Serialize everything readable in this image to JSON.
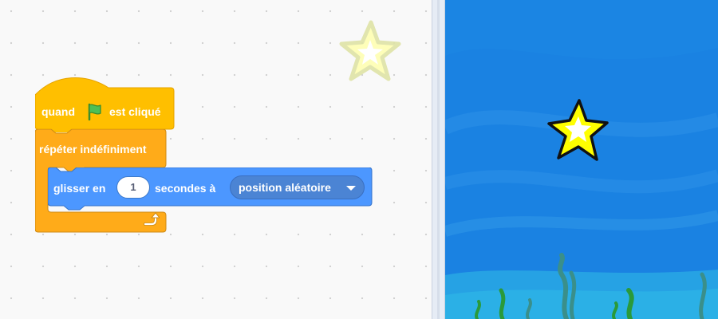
{
  "workspace": {
    "blocks": {
      "hat": {
        "label_before": "quand",
        "label_after": "est cliqué",
        "flag_icon": "green-flag-icon"
      },
      "repeat": {
        "label": "répéter indéfiniment",
        "loop_icon": "loop-arrow-icon"
      },
      "glide": {
        "label_before": "glisser en",
        "seconds_value": "1",
        "label_after": "secondes à",
        "target_option": "position aléatoire"
      }
    },
    "sprite_icon": "star-icon"
  },
  "stage": {
    "sprite_icon": "star-icon",
    "backdrop": "underwater"
  },
  "colors": {
    "events": "#ffbf00",
    "control": "#ffab19",
    "motion": "#4c97ff",
    "stage_blue": "#1a7fe0",
    "star_yellow": "#ffff00"
  }
}
